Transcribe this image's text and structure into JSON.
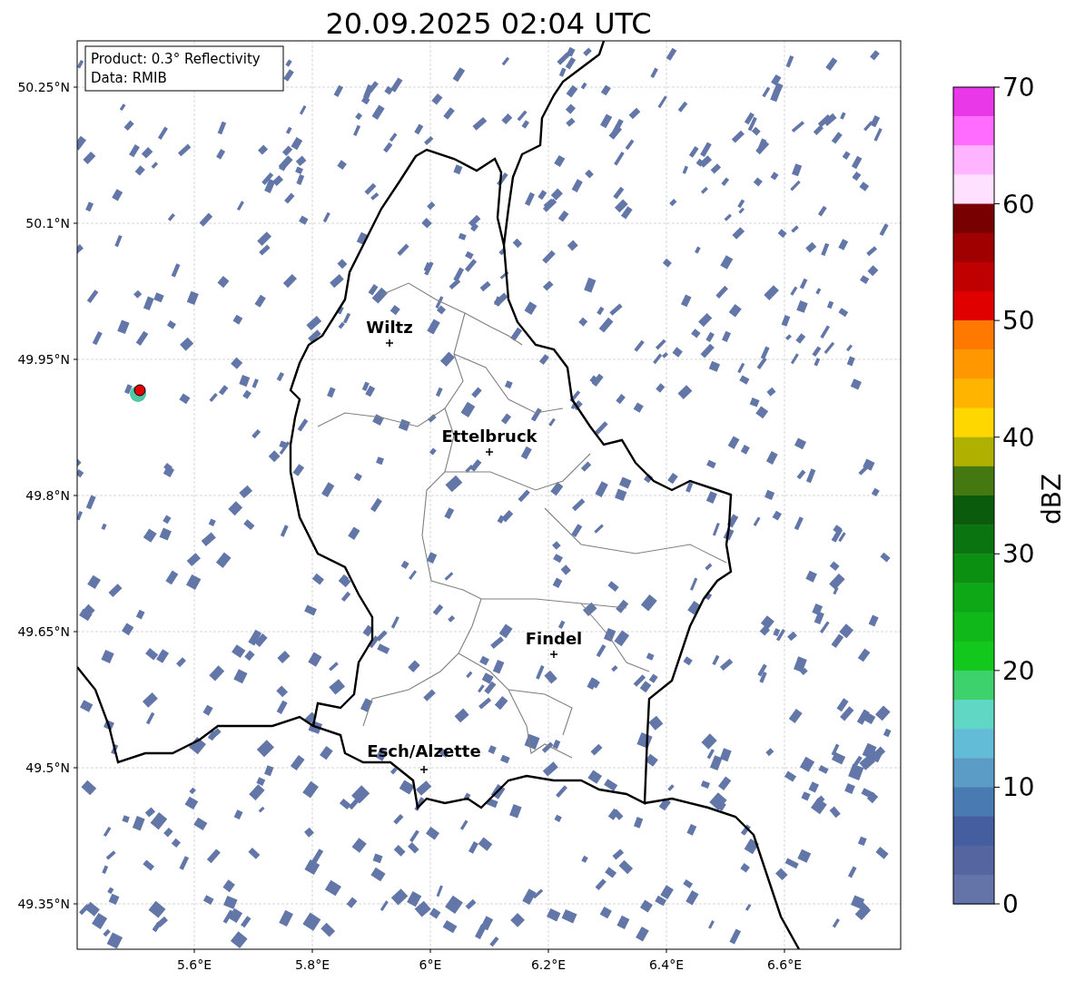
{
  "title": "20.09.2025 02:04 UTC",
  "info_box": [
    "Product: 0.3° Reflectivity",
    "Data: RMIB"
  ],
  "map": {
    "yticks": [
      "50.25°N",
      "50.1°N",
      "49.95°N",
      "49.8°N",
      "49.65°N",
      "49.5°N",
      "49.35°N"
    ],
    "xticks": [
      "5.6°E",
      "5.8°E",
      "6°E",
      "6.2°E",
      "6.4°E",
      "6.6°E"
    ],
    "cities": [
      {
        "name": "Wiltz"
      },
      {
        "name": "Ettelbruck"
      },
      {
        "name": "Findel"
      },
      {
        "name": "Esch/Alzette"
      }
    ]
  },
  "colorbar": {
    "label": "dBZ",
    "ticks": [
      "70",
      "60",
      "50",
      "40",
      "30",
      "20",
      "10",
      "0"
    ],
    "bins": [
      {
        "color": "#e838e8"
      },
      {
        "color": "#ff6cff"
      },
      {
        "color": "#ffb4ff"
      },
      {
        "color": "#ffe0ff"
      },
      {
        "color": "#780000"
      },
      {
        "color": "#a00000"
      },
      {
        "color": "#c00000"
      },
      {
        "color": "#e00000"
      },
      {
        "color": "#ff7800"
      },
      {
        "color": "#ff9800"
      },
      {
        "color": "#ffb400"
      },
      {
        "color": "#ffd700"
      },
      {
        "color": "#b0b000"
      },
      {
        "color": "#447810"
      },
      {
        "color": "#0a5c0c"
      },
      {
        "color": "#0a7410"
      },
      {
        "color": "#0c9012"
      },
      {
        "color": "#0ea816"
      },
      {
        "color": "#10b81a"
      },
      {
        "color": "#12c81c"
      },
      {
        "color": "#3ed26c"
      },
      {
        "color": "#60d6c4"
      },
      {
        "color": "#62bcd8"
      },
      {
        "color": "#5a9cc6"
      },
      {
        "color": "#4a7ab2"
      },
      {
        "color": "#445ea0"
      },
      {
        "color": "#5465a0"
      },
      {
        "color": "#6574a8"
      }
    ]
  }
}
